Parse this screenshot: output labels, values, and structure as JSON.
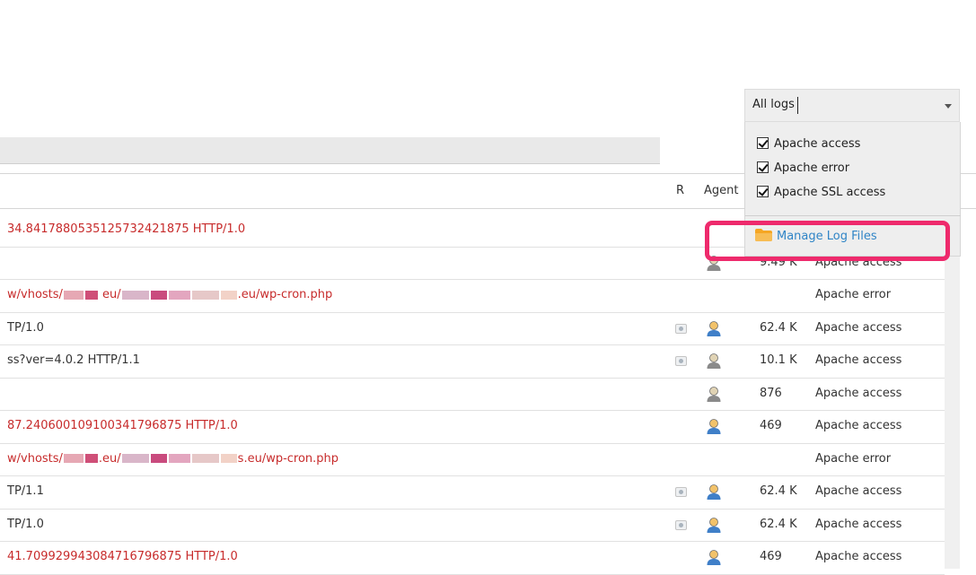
{
  "header": {
    "r_label": "R",
    "agent_label": "Agent"
  },
  "rows": [
    {
      "request": "34.8417880535125732421875 HTTP/1.0",
      "error": true,
      "view": false,
      "agent": "",
      "size": "",
      "type": ""
    },
    {
      "request": "",
      "error": false,
      "view": false,
      "agent": "grey",
      "size": "9.49 K",
      "type": "Apache access"
    },
    {
      "request_pre": "w/vhosts/",
      "request_mid": " eu/",
      "request_post": ".eu/wp-cron.php",
      "error": true,
      "view": false,
      "agent": "",
      "size": "",
      "type": "Apache error",
      "blurred": true
    },
    {
      "request": "TP/1.0",
      "error": false,
      "view": true,
      "agent": "blue",
      "size": "62.4 K",
      "type": "Apache access"
    },
    {
      "request": "ss?ver=4.0.2 HTTP/1.1",
      "error": false,
      "view": true,
      "agent": "grey",
      "size": "10.1 K",
      "type": "Apache access"
    },
    {
      "request": "",
      "error": false,
      "view": false,
      "agent": "grey",
      "size": "876",
      "type": "Apache access"
    },
    {
      "request": "87.240600109100341796875 HTTP/1.0",
      "error": true,
      "view": false,
      "agent": "blue",
      "size": "469",
      "type": "Apache access"
    },
    {
      "request_pre": "w/vhosts/",
      "request_mid": ".eu/",
      "request_post": "s.eu/wp-cron.php",
      "error": true,
      "view": false,
      "agent": "",
      "size": "",
      "type": "Apache error",
      "blurred": true
    },
    {
      "request": "TP/1.1",
      "error": false,
      "view": true,
      "agent": "blue",
      "size": "62.4 K",
      "type": "Apache access"
    },
    {
      "request": "TP/1.0",
      "error": false,
      "view": true,
      "agent": "blue",
      "size": "62.4 K",
      "type": "Apache access"
    },
    {
      "request": "41.709929943084716796875 HTTP/1.0",
      "error": true,
      "view": false,
      "agent": "blue",
      "size": "469",
      "type": "Apache access"
    }
  ],
  "log_select": {
    "value": "All logs",
    "options": [
      {
        "label": "Apache access",
        "checked": true
      },
      {
        "label": "Apache error",
        "checked": true
      },
      {
        "label": "Apache SSL access",
        "checked": true
      }
    ],
    "manage_label": "Manage Log Files"
  },
  "colors": {
    "error_text": "#c72b2b",
    "link": "#2f84c6",
    "highlight": "#ee2a6c",
    "folder": "#f5a623"
  }
}
